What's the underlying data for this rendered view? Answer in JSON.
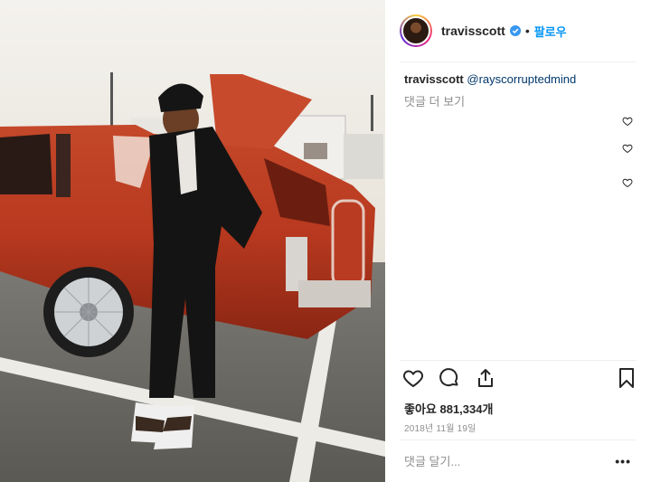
{
  "post": {
    "username": "travisscott",
    "follow_label": "팔로우",
    "dot": "•",
    "photo_alt_icon": "photo-man-leaning-on-red-lowrider-car"
  },
  "comments": [
    {
      "author": "travisscott",
      "text": "@rayscorruptedmind"
    }
  ],
  "more_comments_label": "댓글 더 보기",
  "likes_text": "좋아요 881,334개",
  "date_text": "2018년 11월 19일",
  "add_comment_placeholder": "댓글 달기...",
  "options_label": "•••",
  "colors": {
    "link": "#0095f6",
    "mention": "#00376b",
    "muted": "#8e8e8e",
    "verified": "#3897f0"
  }
}
